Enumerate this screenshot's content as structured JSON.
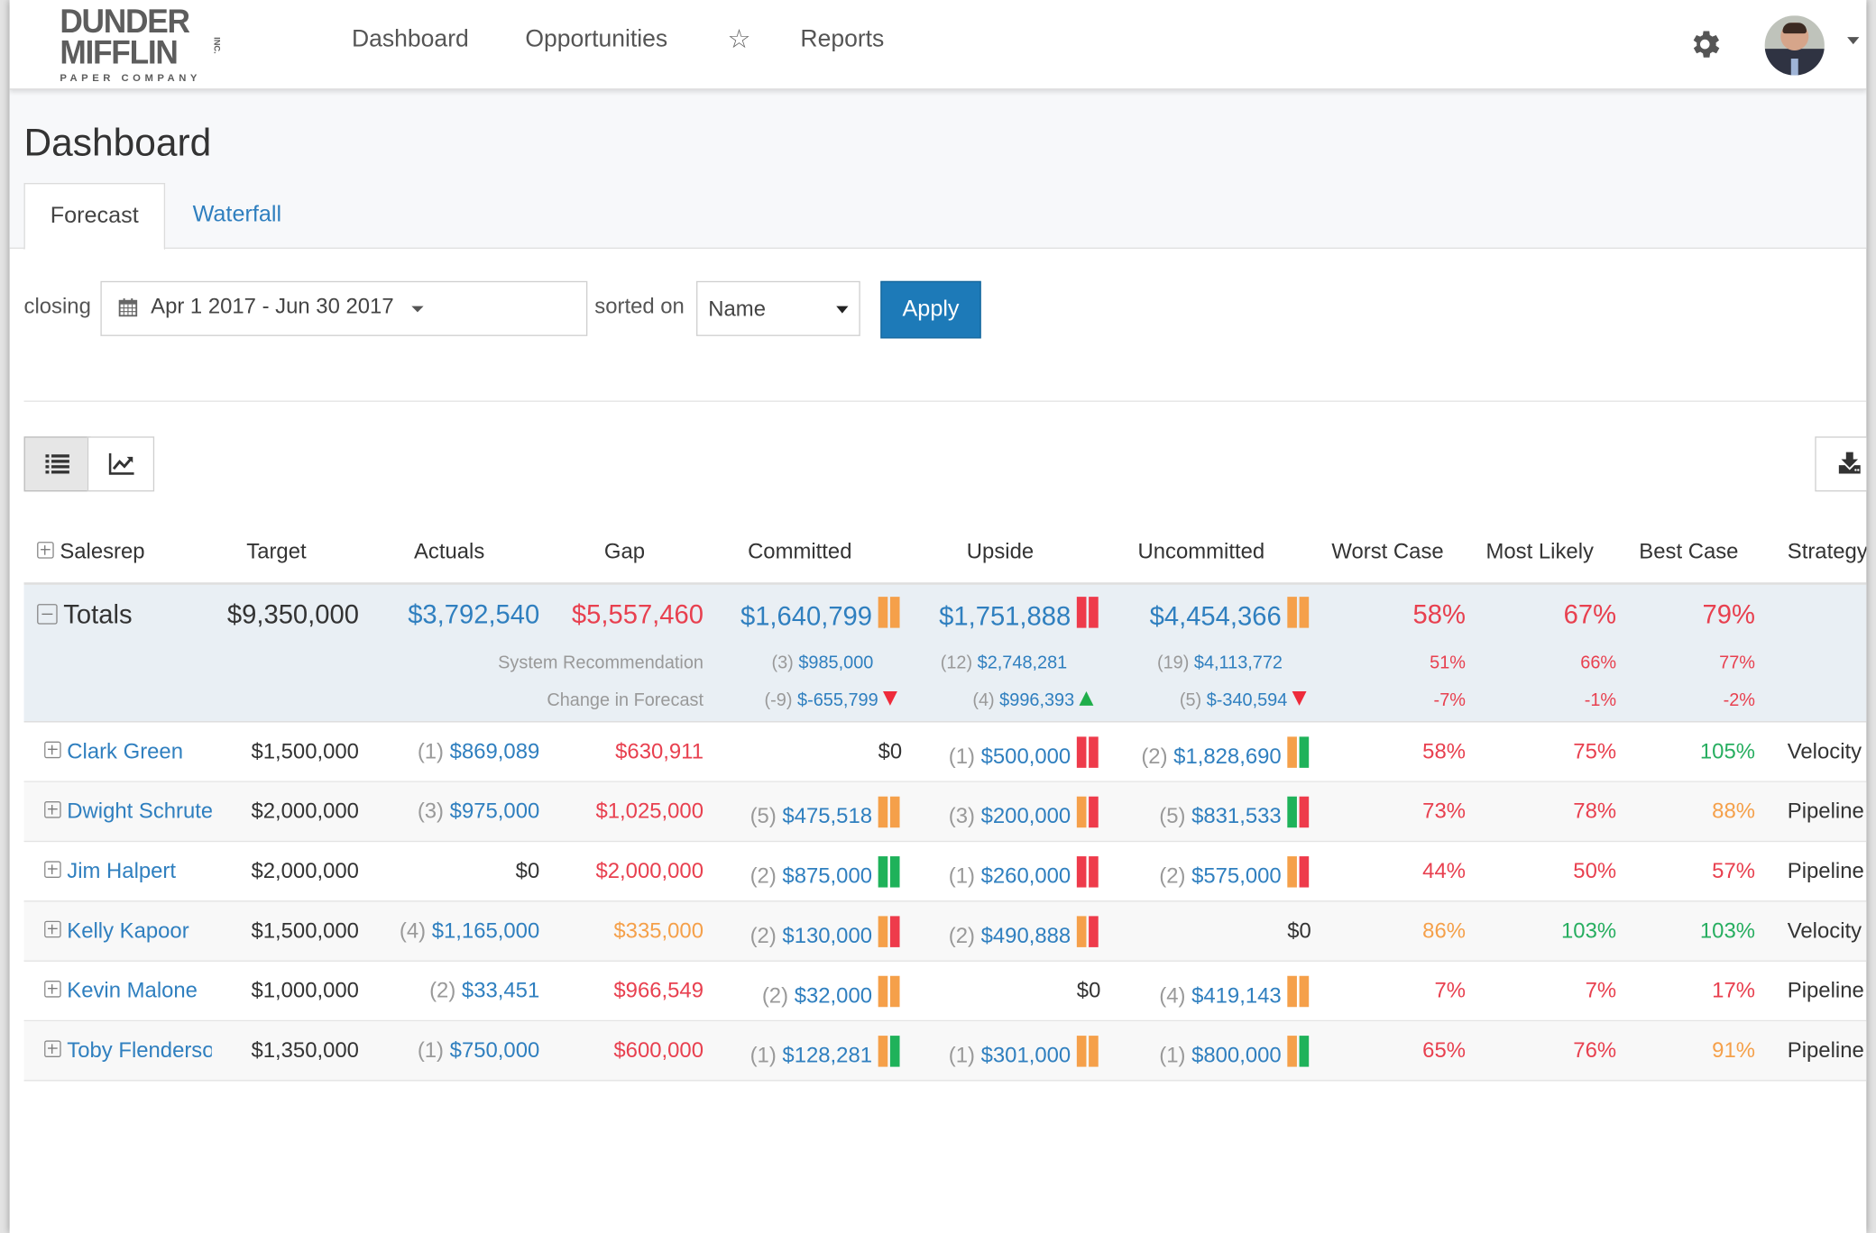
{
  "brand": {
    "line1": "DUNDER",
    "line2": "MIFFLIN",
    "line3": "PAPER COMPANY",
    "inc": "INC."
  },
  "nav": {
    "items": [
      {
        "label": "Dashboard"
      },
      {
        "label": "Opportunities"
      },
      {
        "label": "Reports"
      }
    ],
    "favorites_icon": "star-outline-icon",
    "settings_icon": "gear-icon",
    "user_menu_icon": "avatar"
  },
  "page": {
    "title": "Dashboard",
    "tabs": [
      {
        "label": "Forecast",
        "active": true
      },
      {
        "label": "Waterfall",
        "active": false
      }
    ]
  },
  "filters": {
    "closing_label": "closing",
    "date_range": "Apr 1 2017 - Jun 30 2017",
    "sorted_label": "sorted on",
    "sort_value": "Name",
    "apply_label": "Apply"
  },
  "view": {
    "list_icon": "list-icon",
    "chart_icon": "line-chart-icon",
    "download_icon": "download-icon",
    "active": "list"
  },
  "colors": {
    "blue": "#2f7fbf",
    "red": "#e8404f",
    "orange": "#f5a04a",
    "green": "#27ae60",
    "apply": "#1d7ab8",
    "totals_bg": "#e9eff4"
  },
  "table": {
    "columns": [
      "Salesrep",
      "Target",
      "Actuals",
      "Gap",
      "Committed",
      "Upside",
      "Uncommitted",
      "Worst Case",
      "Most Likely",
      "Best Case",
      "Strategy"
    ],
    "totals": {
      "label": "Totals",
      "target": "$9,350,000",
      "actuals": "$3,792,540",
      "gap": "$5,557,460",
      "committed": {
        "value": "$1,640,799",
        "bars": [
          "orange",
          "orange"
        ]
      },
      "upside": {
        "value": "$1,751,888",
        "bars": [
          "red",
          "red"
        ]
      },
      "uncommitted": {
        "value": "$4,454,366",
        "bars": [
          "orange",
          "orange"
        ]
      },
      "worst": "58%",
      "likely": "67%",
      "best": "79%",
      "system_recommendation": {
        "label": "System Recommendation",
        "committed": {
          "count": "(3)",
          "value": "$985,000"
        },
        "upside": {
          "count": "(12)",
          "value": "$2,748,281"
        },
        "uncommitted": {
          "count": "(19)",
          "value": "$4,113,772"
        },
        "worst": "51%",
        "likely": "66%",
        "best": "77%"
      },
      "change_in_forecast": {
        "label": "Change in Forecast",
        "committed": {
          "count": "(-9)",
          "value": "$-655,799",
          "trend": "down"
        },
        "upside": {
          "count": "(4)",
          "value": "$996,393",
          "trend": "up"
        },
        "uncommitted": {
          "count": "(5)",
          "value": "$-340,594",
          "trend": "down"
        },
        "worst": "-7%",
        "likely": "-1%",
        "best": "-2%"
      }
    },
    "rows": [
      {
        "name": "Clark Green",
        "target": "$1,500,000",
        "actuals": {
          "count": "(1)",
          "value": "$869,089"
        },
        "gap": {
          "value": "$630,911",
          "color": "red"
        },
        "committed": {
          "count": "",
          "value": "$0",
          "bars": []
        },
        "upside": {
          "count": "(1)",
          "value": "$500,000",
          "bars": [
            "red",
            "red"
          ]
        },
        "uncommitted": {
          "count": "(2)",
          "value": "$1,828,690",
          "bars": [
            "orange",
            "green"
          ]
        },
        "worst": {
          "value": "58%",
          "color": "red"
        },
        "likely": {
          "value": "75%",
          "color": "red"
        },
        "best": {
          "value": "105%",
          "color": "green"
        },
        "strategy": "Velocity"
      },
      {
        "name": "Dwight Schrute",
        "target": "$2,000,000",
        "actuals": {
          "count": "(3)",
          "value": "$975,000"
        },
        "gap": {
          "value": "$1,025,000",
          "color": "red"
        },
        "committed": {
          "count": "(5)",
          "value": "$475,518",
          "bars": [
            "orange",
            "orange"
          ]
        },
        "upside": {
          "count": "(3)",
          "value": "$200,000",
          "bars": [
            "orange",
            "red"
          ]
        },
        "uncommitted": {
          "count": "(5)",
          "value": "$831,533",
          "bars": [
            "green",
            "red"
          ]
        },
        "worst": {
          "value": "73%",
          "color": "red"
        },
        "likely": {
          "value": "78%",
          "color": "red"
        },
        "best": {
          "value": "88%",
          "color": "orange"
        },
        "strategy": "Pipeline"
      },
      {
        "name": "Jim Halpert",
        "target": "$2,000,000",
        "actuals": {
          "count": "",
          "value": "$0"
        },
        "gap": {
          "value": "$2,000,000",
          "color": "red"
        },
        "committed": {
          "count": "(2)",
          "value": "$875,000",
          "bars": [
            "green",
            "green"
          ]
        },
        "upside": {
          "count": "(1)",
          "value": "$260,000",
          "bars": [
            "red",
            "red"
          ]
        },
        "uncommitted": {
          "count": "(2)",
          "value": "$575,000",
          "bars": [
            "orange",
            "red"
          ]
        },
        "worst": {
          "value": "44%",
          "color": "red"
        },
        "likely": {
          "value": "50%",
          "color": "red"
        },
        "best": {
          "value": "57%",
          "color": "red"
        },
        "strategy": "Pipeline"
      },
      {
        "name": "Kelly Kapoor",
        "target": "$1,500,000",
        "actuals": {
          "count": "(4)",
          "value": "$1,165,000"
        },
        "gap": {
          "value": "$335,000",
          "color": "orange"
        },
        "committed": {
          "count": "(2)",
          "value": "$130,000",
          "bars": [
            "orange",
            "red"
          ]
        },
        "upside": {
          "count": "(2)",
          "value": "$490,888",
          "bars": [
            "orange",
            "red"
          ]
        },
        "uncommitted": {
          "count": "",
          "value": "$0",
          "bars": []
        },
        "worst": {
          "value": "86%",
          "color": "orange"
        },
        "likely": {
          "value": "103%",
          "color": "green"
        },
        "best": {
          "value": "103%",
          "color": "green"
        },
        "strategy": "Velocity"
      },
      {
        "name": "Kevin Malone",
        "target": "$1,000,000",
        "actuals": {
          "count": "(2)",
          "value": "$33,451"
        },
        "gap": {
          "value": "$966,549",
          "color": "red"
        },
        "committed": {
          "count": "(2)",
          "value": "$32,000",
          "bars": [
            "orange",
            "orange"
          ]
        },
        "upside": {
          "count": "",
          "value": "$0",
          "bars": []
        },
        "uncommitted": {
          "count": "(4)",
          "value": "$419,143",
          "bars": [
            "orange",
            "orange"
          ]
        },
        "worst": {
          "value": "7%",
          "color": "red"
        },
        "likely": {
          "value": "7%",
          "color": "red"
        },
        "best": {
          "value": "17%",
          "color": "red"
        },
        "strategy": "Pipeline"
      },
      {
        "name": "Toby Flenderson",
        "target": "$1,350,000",
        "actuals": {
          "count": "(1)",
          "value": "$750,000"
        },
        "gap": {
          "value": "$600,000",
          "color": "red"
        },
        "committed": {
          "count": "(1)",
          "value": "$128,281",
          "bars": [
            "orange",
            "green"
          ]
        },
        "upside": {
          "count": "(1)",
          "value": "$301,000",
          "bars": [
            "orange",
            "orange"
          ]
        },
        "uncommitted": {
          "count": "(1)",
          "value": "$800,000",
          "bars": [
            "orange",
            "green"
          ]
        },
        "worst": {
          "value": "65%",
          "color": "red"
        },
        "likely": {
          "value": "76%",
          "color": "red"
        },
        "best": {
          "value": "91%",
          "color": "orange"
        },
        "strategy": "Pipeline"
      }
    ]
  }
}
